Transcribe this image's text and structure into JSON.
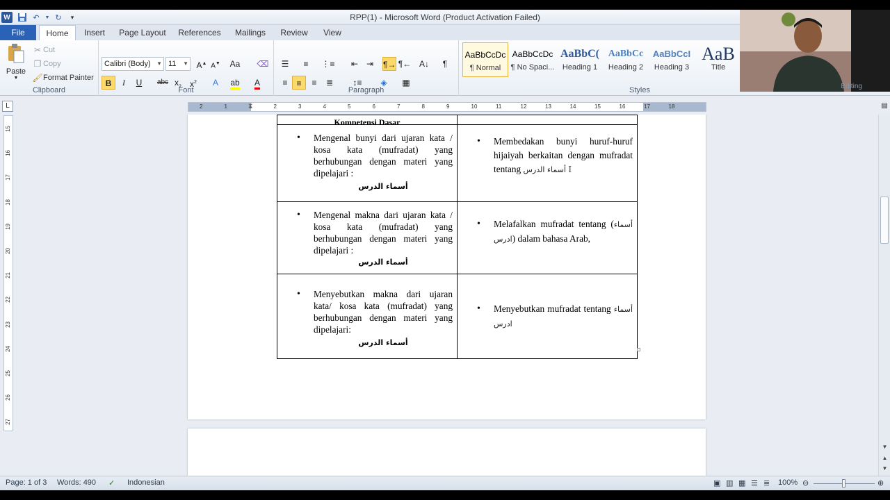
{
  "window": {
    "title": "RPP(1) - Microsoft Word (Product Activation Failed)"
  },
  "tabs": [
    "File",
    "Home",
    "Insert",
    "Page Layout",
    "References",
    "Mailings",
    "Review",
    "View"
  ],
  "ribbon": {
    "clipboard": {
      "label": "Clipboard",
      "paste": "Paste",
      "cut": "Cut",
      "copy": "Copy",
      "format_painter": "Format Painter"
    },
    "font": {
      "label": "Font",
      "font_name": "Calibri (Body)",
      "font_size": "11"
    },
    "paragraph": {
      "label": "Paragraph"
    },
    "styles": {
      "label": "Styles",
      "items": [
        {
          "sample": "AaBbCcDc",
          "name": "¶ Normal"
        },
        {
          "sample": "AaBbCcDc",
          "name": "¶ No Spaci..."
        },
        {
          "sample": "AaBbC(",
          "name": "Heading 1"
        },
        {
          "sample": "AaBbCc",
          "name": "Heading 2"
        },
        {
          "sample": "AaBbCcI",
          "name": "Heading 3"
        },
        {
          "sample": "AaB",
          "name": "Title"
        }
      ]
    },
    "editing": {
      "label": "Editing"
    }
  },
  "document": {
    "header_cut": "Kompetensi Dasar",
    "rows": [
      {
        "left": "Mengenal bunyi dari ujaran kata / kosa kata (mufradat) yang berhubungan dengan materi yang dipelajari :",
        "left_arabic": "أسماء الدرس",
        "right": "Membedakan bunyi huruf-huruf hijaiyah berkaitan dengan mufradat tentang",
        "right_arabic": "أسماء الدرس"
      },
      {
        "left": "Mengenal makna dari ujaran kata / kosa kata (mufradat) yang berhubungan dengan materi yang dipelajari :",
        "left_arabic": "أسماء الدرس",
        "right_pre": "Melafalkan mufradat tentang (",
        "right_arabic": "أسماء ادرس",
        "right_post": ") dalam bahasa Arab,"
      },
      {
        "left": "Menyebutkan makna dari ujaran kata/ kosa kata (mufradat) yang berhubungan dengan materi yang dipelajari:",
        "left_arabic": "أسماء الدرس",
        "right": "Menyebutkan mufradat tentang",
        "right_arabic": "أسماء ادرس"
      }
    ]
  },
  "ruler_ticks": [
    "2",
    "1",
    "1",
    "2",
    "3",
    "4",
    "5",
    "6",
    "7",
    "8",
    "9",
    "10",
    "11",
    "12",
    "13",
    "14",
    "15",
    "16",
    "17",
    "18"
  ],
  "vruler_ticks": [
    "15",
    "16",
    "17",
    "18",
    "19",
    "20",
    "21",
    "22",
    "23",
    "24",
    "25",
    "26",
    "27"
  ],
  "status": {
    "page": "Page: 1 of 3",
    "words": "Words: 490",
    "language": "Indonesian",
    "zoom": "100%"
  }
}
